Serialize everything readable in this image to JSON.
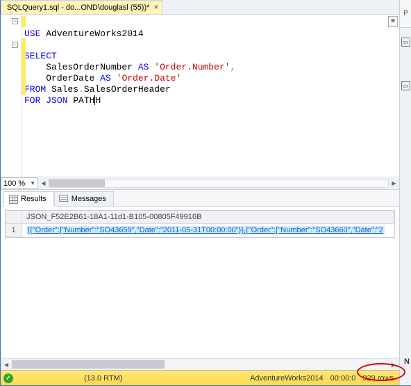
{
  "tab": {
    "title": "SQLQuery1.sql - do...OND\\douglasl (55))*"
  },
  "rightStrip": {
    "tabLabel": "P",
    "glyphs": [
      "▭",
      "▭"
    ]
  },
  "editor": {
    "zoom": "100 %",
    "code": {
      "l1_kw": "USE",
      "l1_db": "AdventureWorks2014",
      "l2": "",
      "l3_kw": "SELECT",
      "l4_a": "SalesOrderNumber",
      "l4_as": "AS",
      "l4_s": "'Order.Number'",
      "l5_a": "OrderDate",
      "l5_as": "AS",
      "l5_s": "'Order.Date'",
      "l6_kw": "FROM",
      "l6_a": "Sales",
      "l6_dot": ".",
      "l6_b": "SalesOrderHeader",
      "l7_kw": "FOR",
      "l7_b": "JSON",
      "l7_c": "PATH"
    }
  },
  "resultTabs": {
    "results": "Results",
    "messages": "Messages"
  },
  "grid": {
    "columnHeader": "JSON_F52E2B61-18A1-11d1-B105-00805F49916B",
    "rowNum": "1",
    "cellValue": "[{\"Order\":{\"Number\":\"SO43659\",\"Date\":\"2011-05-31T00:00:00\"}},{\"Order\":{\"Number\":\"SO43660\",\"Date\":\"2"
  },
  "status": {
    "version": "(13.0 RTM)",
    "db": "AdventureWorks2014",
    "time": "00:00:0",
    "rows": "929 rows"
  },
  "annot": {
    "N": "N"
  }
}
